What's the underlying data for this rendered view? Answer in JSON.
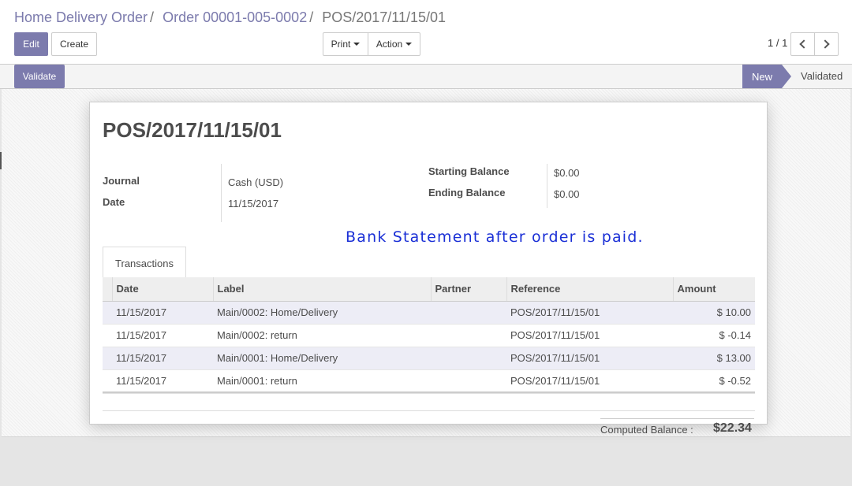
{
  "breadcrumb": {
    "items": [
      "Home Delivery Order",
      "Order 00001-005-0002"
    ],
    "current": "POS/2017/11/15/01",
    "separator": "/"
  },
  "toolbar": {
    "edit_label": "Edit",
    "create_label": "Create",
    "print_label": "Print",
    "action_label": "Action"
  },
  "pager": {
    "value": "1 / 1"
  },
  "statusbar": {
    "validate_label": "Validate",
    "stages": [
      "New",
      "Validated"
    ],
    "active_stage": "New"
  },
  "record": {
    "title": "POS/2017/11/15/01",
    "journal_label": "Journal",
    "journal_value": "Cash (USD)",
    "date_label": "Date",
    "date_value": "11/15/2017",
    "starting_balance_label": "Starting Balance",
    "starting_balance_value": "$0.00",
    "ending_balance_label": "Ending Balance",
    "ending_balance_value": "$0.00"
  },
  "annotation": "Bank Statement after order is paid.",
  "tabs": [
    {
      "label": "Transactions"
    }
  ],
  "transactions": {
    "columns": [
      "Date",
      "Label",
      "Partner",
      "Reference",
      "Amount"
    ],
    "rows": [
      {
        "date": "11/15/2017",
        "label": "Main/0002: Home/Delivery",
        "partner": "",
        "reference": "POS/2017/11/15/01",
        "amount": "$ 10.00"
      },
      {
        "date": "11/15/2017",
        "label": "Main/0002: return",
        "partner": "",
        "reference": "POS/2017/11/15/01",
        "amount": "$ -0.14"
      },
      {
        "date": "11/15/2017",
        "label": "Main/0001: Home/Delivery",
        "partner": "",
        "reference": "POS/2017/11/15/01",
        "amount": "$ 13.00"
      },
      {
        "date": "11/15/2017",
        "label": "Main/0001: return",
        "partner": "",
        "reference": "POS/2017/11/15/01",
        "amount": "$ -0.52"
      }
    ]
  },
  "computed_balance": {
    "label": "Computed Balance :",
    "value": "$22.34"
  },
  "colors": {
    "brand": "#7c7bad",
    "annotation": "#1a2fd6",
    "odd_row": "#ededf6"
  },
  "icons": {
    "pager_prev": "chevron-left-icon",
    "pager_next": "chevron-right-icon",
    "dropdown": "caret-down-icon"
  }
}
